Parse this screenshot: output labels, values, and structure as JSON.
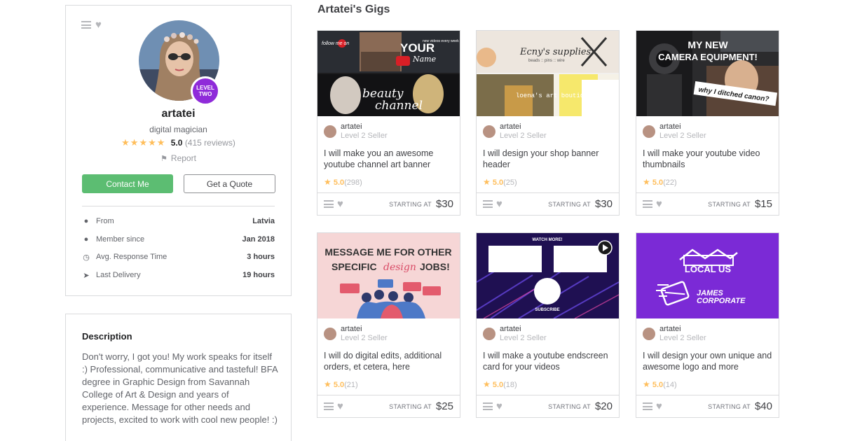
{
  "profile": {
    "username": "artatei",
    "tagline": "digital magician",
    "level_badge_line1": "LEVEL",
    "level_badge_line2": "TWO",
    "stars": "★★★★★",
    "rating_score": "5.0",
    "rating_count": "(415 reviews)",
    "report_label": "Report",
    "contact_label": "Contact Me",
    "quote_label": "Get a Quote",
    "stats": [
      {
        "icon": "location-pin-icon",
        "label": "From",
        "value": "Latvia"
      },
      {
        "icon": "user-icon",
        "label": "Member since",
        "value": "Jan 2018"
      },
      {
        "icon": "clock-icon",
        "label": "Avg. Response Time",
        "value": "3 hours"
      },
      {
        "icon": "send-icon",
        "label": "Last Delivery",
        "value": "19 hours"
      }
    ]
  },
  "description": {
    "title": "Description",
    "text": "Don't worry, I got you! My work speaks for itself :) Professional, communicative and tasteful! BFA degree in Graphic Design from Savannah College of Art & Design and years of experience. Message for other needs and projects, excited to work with cool new people! :)"
  },
  "gigs_title": "Artatei's Gigs",
  "gigs": [
    {
      "seller": "artatei",
      "level": "Level 2 Seller",
      "title": "I will make you an awesome youtube channel art banner",
      "score": "5.0",
      "count": "(298)",
      "starting": "STARTING AT",
      "price": "$30",
      "thumb_text": [
        "YOUR",
        "Name",
        "beauty",
        "channel",
        "new videos every week",
        "follow me on"
      ]
    },
    {
      "seller": "artatei",
      "level": "Level 2 Seller",
      "title": "I will design your shop banner header",
      "score": "5.0",
      "count": "(25)",
      "starting": "STARTING AT",
      "price": "$30",
      "thumb_text": [
        "Ecny's supplies",
        "beads :: pins :: wire",
        "loena's art boutique"
      ]
    },
    {
      "seller": "artatei",
      "level": "Level 2 Seller",
      "title": "I will make your youtube video thumbnails",
      "score": "5.0",
      "count": "(22)",
      "starting": "STARTING AT",
      "price": "$15",
      "thumb_text": [
        "MY NEW",
        "CAMERA EQUIPMENT!",
        "why I ditched canon?"
      ]
    },
    {
      "seller": "artatei",
      "level": "Level 2 Seller",
      "title": "I will do digital edits, additional orders, et cetera, here",
      "score": "5.0",
      "count": "(21)",
      "starting": "STARTING AT",
      "price": "$25",
      "thumb_text": [
        "MESSAGE ME FOR OTHER",
        "SPECIFIC",
        "design",
        "JOBS!"
      ]
    },
    {
      "seller": "artatei",
      "level": "Level 2 Seller",
      "title": "I will make a youtube endscreen card for your videos",
      "score": "5.0",
      "count": "(18)",
      "starting": "STARTING AT",
      "price": "$20",
      "thumb_text": [
        "WATCH MORE!",
        "SUBSCRIBE"
      ]
    },
    {
      "seller": "artatei",
      "level": "Level 2 Seller",
      "title": "I will design your own unique and awesome logo and more",
      "score": "5.0",
      "count": "(14)",
      "starting": "STARTING AT",
      "price": "$40",
      "thumb_text": [
        "LOCAL US",
        "JAMES",
        "CORPORATE"
      ]
    }
  ],
  "colors": {
    "contact_green": "#5cbd72",
    "star_yellow": "#ffbe5b",
    "level_purple": "#8f2bd9",
    "logo_purple": "#7b2ad6"
  }
}
